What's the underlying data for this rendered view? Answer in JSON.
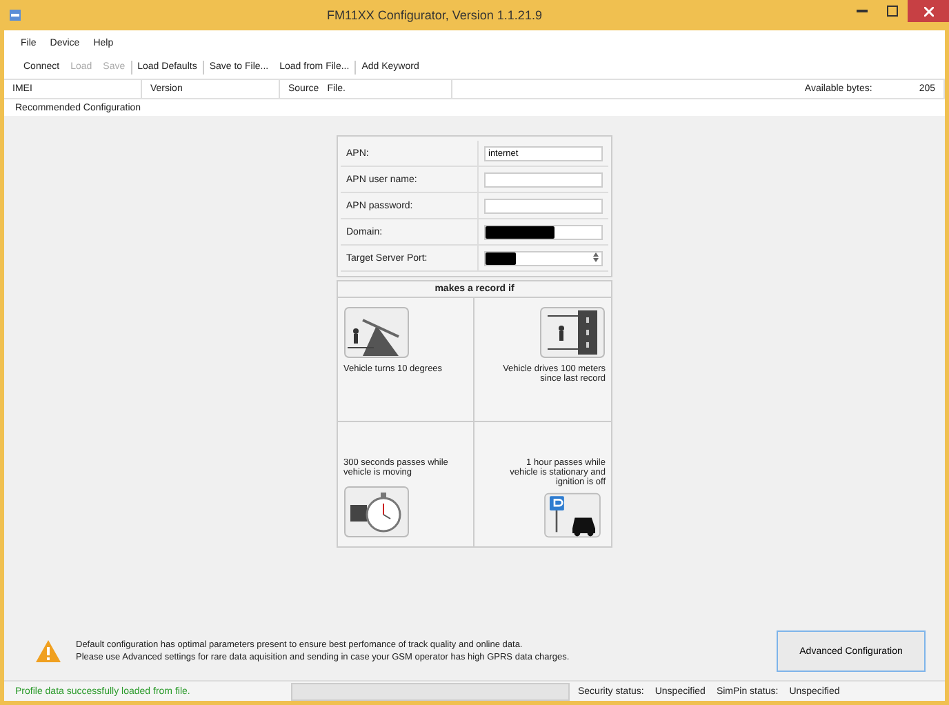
{
  "window": {
    "title": "FM11XX Configurator, Version 1.1.21.9"
  },
  "menu": [
    "File",
    "Device",
    "Help"
  ],
  "toolbar": [
    {
      "label": "Connect",
      "disabled": false
    },
    {
      "label": "Load",
      "disabled": true
    },
    {
      "label": "Save",
      "disabled": true
    },
    {
      "label": "Load Defaults",
      "disabled": false
    },
    {
      "label": "Save to File...",
      "disabled": false
    },
    {
      "label": "Load from File...",
      "disabled": false
    },
    {
      "label": "Add Keyword",
      "disabled": false
    }
  ],
  "info_bar": {
    "imei_label": "IMEI",
    "version_label": "Version",
    "source_label": "Source",
    "source_value": "File.",
    "available_label": "Available bytes:",
    "available_value": "205"
  },
  "section_title": "Recommended Configuration",
  "fields": [
    {
      "label": "APN:",
      "value": "internet",
      "kind": "text"
    },
    {
      "label": "APN user name:",
      "kind": "text"
    },
    {
      "label": "APN password:",
      "kind": "text"
    },
    {
      "label": "Domain:",
      "kind": "redacted"
    },
    {
      "label": "Target Server Port:",
      "kind": "redacted-spin"
    }
  ],
  "record_header": "makes a record if",
  "conditions": [
    {
      "text": "Vehicle turns 10 degrees",
      "kind": "turn",
      "icon_first": true
    },
    {
      "text": "Vehicle drives 100 meters since last record",
      "kind": "distance",
      "icon_first": true
    },
    {
      "text": "300 seconds passes while vehicle is moving",
      "kind": "timer",
      "icon_first": false
    },
    {
      "text": "1 hour passes while vehicle is stationary and ignition is off",
      "kind": "parking",
      "icon_first": false
    }
  ],
  "warning": [
    "Default configuration has optimal parameters present to ensure best perfomance of track quality and online data.",
    "Please use Advanced settings for rare data aquisition and sending in case your GSM operator has high GPRS data charges."
  ],
  "advanced_button": "Advanced Configuration",
  "status_bar": {
    "message": "Profile data successfully loaded from file.",
    "security_label": "Security status:",
    "security_value": "Unspecified",
    "simpin_label": "SimPin status:",
    "simpin_value": "Unspecified"
  }
}
